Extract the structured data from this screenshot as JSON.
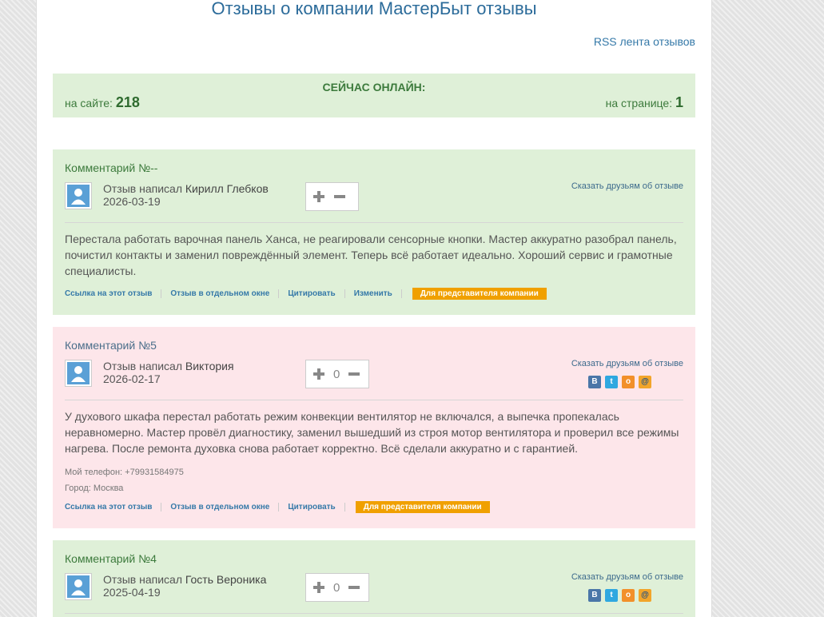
{
  "page": {
    "title": "Отзывы о компании МастерБыт отзывы",
    "rss_link": "RSS лента отзывов"
  },
  "online": {
    "title": "СЕЙЧАС ОНЛАЙН:",
    "site_label": "на сайте:",
    "site_count": "218",
    "page_label": "на странице:",
    "page_count": "1"
  },
  "colors": {
    "green_bg": "#dff0d8",
    "pink_bg": "#fde6ea",
    "link": "#3579a8",
    "badge": "#f0a000"
  },
  "comments": [
    {
      "number": "Комментарий №--",
      "author_prefix": "Отзыв написал",
      "author": "Кирилл Глебков",
      "date": "2026-03-19",
      "share_label": "Сказать друзьям об отзыве",
      "text": "Перестала работать варочная панель Ханса, не реагировали сенсорные кнопки. Мастер аккуратно разобрал панель, почистил контакты и заменил повреждённый элемент. Теперь всё работает идеально. Хороший сервис и грамотные специалисты.",
      "links": {
        "permalink": "Ссылка на этот отзыв",
        "window": "Отзыв в отдельном окне",
        "quote": "Цитировать",
        "edit": "Изменить",
        "rep": "Для представителя компании"
      }
    },
    {
      "number": "Комментарий №5",
      "author_prefix": "Отзыв написал",
      "author": "Виктория",
      "date": "2026-02-17",
      "votes": "0",
      "share_label": "Сказать друзьям об отзыве",
      "social": [
        "В",
        "t",
        "о",
        "@"
      ],
      "text": "У духового шкафа перестал работать режим конвекции  вентилятор не включался, а выпечка пропекалась неравномерно. Мастер провёл диагностику, заменил вышедший из строя мотор вентилятора и проверил все режимы нагрева. После ремонта духовка снова работает корректно. Всё сделали аккуратно и с гарантией.",
      "phone": "Мой телефон: +79931584975",
      "city": "Город: Москва",
      "links": {
        "permalink": "Ссылка на этот отзыв",
        "window": "Отзыв в отдельном окне",
        "quote": "Цитировать",
        "rep": "Для представителя компании"
      }
    },
    {
      "number": "Комментарий №4",
      "author_prefix": "Отзыв написал",
      "author": "Гость Вероника",
      "date": "2025-04-19",
      "votes": "0",
      "share_label": "Сказать друзьям об отзыве",
      "social": [
        "В",
        "t",
        "о",
        "@"
      ]
    }
  ]
}
